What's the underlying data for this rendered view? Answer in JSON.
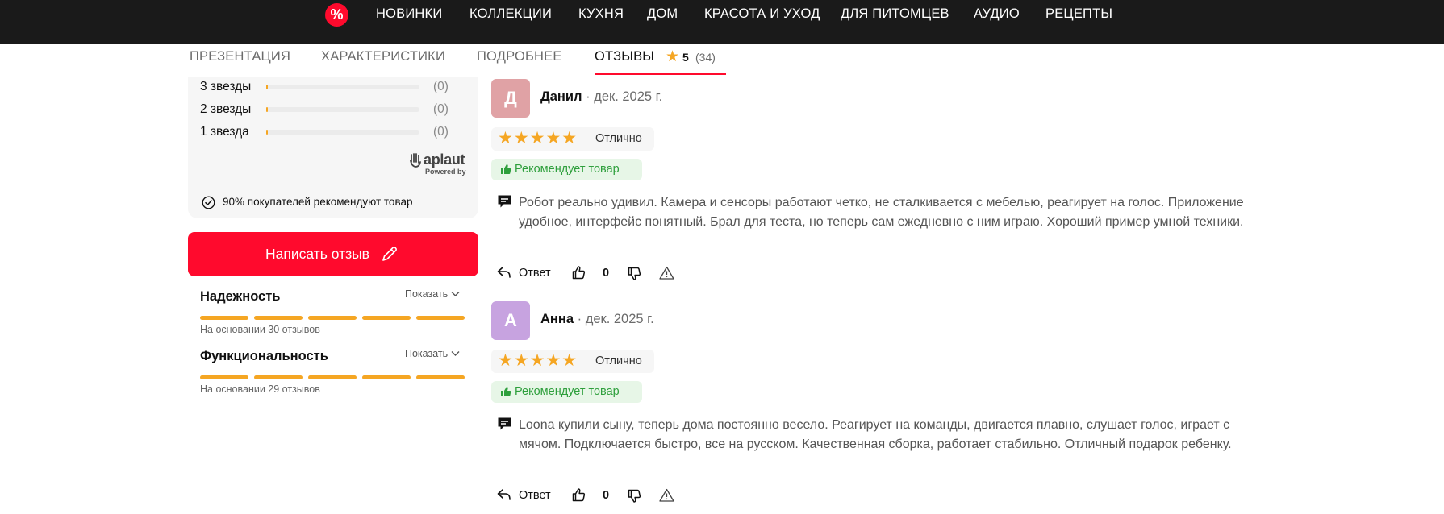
{
  "nav": {
    "sale_icon": "%",
    "items": [
      "НОВИНКИ",
      "КОЛЛЕКЦИИ",
      "КУХНЯ",
      "ДОМ",
      "КРАСОТА И УХОД",
      "ДЛЯ ПИТОМЦЕВ",
      "АУДИО",
      "РЕЦЕПТЫ"
    ]
  },
  "tabs": {
    "items": [
      "ПРЕЗЕНТАЦИЯ",
      "ХАРАКТЕРИСТИКИ",
      "ПОДРОБНЕЕ",
      "ОТЗЫВЫ"
    ],
    "active": "ОТЗЫВЫ",
    "score": "5",
    "count": "(34)"
  },
  "summary": {
    "rows": [
      {
        "label": "3 звезды",
        "count": "(0)",
        "fraction": 0
      },
      {
        "label": "2 звезды",
        "count": "(0)",
        "fraction": 0
      },
      {
        "label": "1 звезда",
        "count": "(0)",
        "fraction": 0
      }
    ],
    "brand": "aplaut",
    "powered": "Powered by",
    "recommend": "90% покупателей рекомендуют товар"
  },
  "write_button": "Написать отзыв",
  "attributes": [
    {
      "title": "Надежность",
      "toggle": "Показать",
      "note": "На основании 30 отзывов",
      "rating": 5
    },
    {
      "title": "Функциональность",
      "toggle": "Показать",
      "note": "На основании 29 отзывов",
      "rating": 5
    }
  ],
  "reviews": [
    {
      "initial": "Д",
      "name": "Данил",
      "date": " · дек. 2025 г.",
      "avatar_color": "#e0a2a5",
      "stars": 5,
      "rating_label": "Отлично",
      "recommend": "Рекомендует товар",
      "text": "Робот реально удивил. Камера и сенсоры работают четко, не сталкивается с мебелью, реагирует на голос. Приложение удобное, интерфейс понятный. Брал для теста, но теперь сам ежедневно с ним играю. Хороший пример умной техники.",
      "reply": "Ответ",
      "votes": "0"
    },
    {
      "initial": "А",
      "name": "Анна",
      "date": " · дек. 2025 г.",
      "avatar_color": "#c7a3e0",
      "stars": 5,
      "rating_label": "Отлично",
      "recommend": "Рекомендует товар",
      "text": "Loona купили сыну, теперь дома постоянно весело. Реагирует на команды, двигается плавно, слушает голос, играет с мячом. Подключается быстро, все на русском. Качественная сборка, работает стабильно. Отличный подарок ребенку.",
      "reply": "Ответ",
      "votes": "0"
    }
  ],
  "colors": {
    "accent": "#ff0a2d",
    "star": "#f5a623",
    "recommend_green": "#2e9f3c",
    "nav_bg": "#1a1a1a"
  }
}
